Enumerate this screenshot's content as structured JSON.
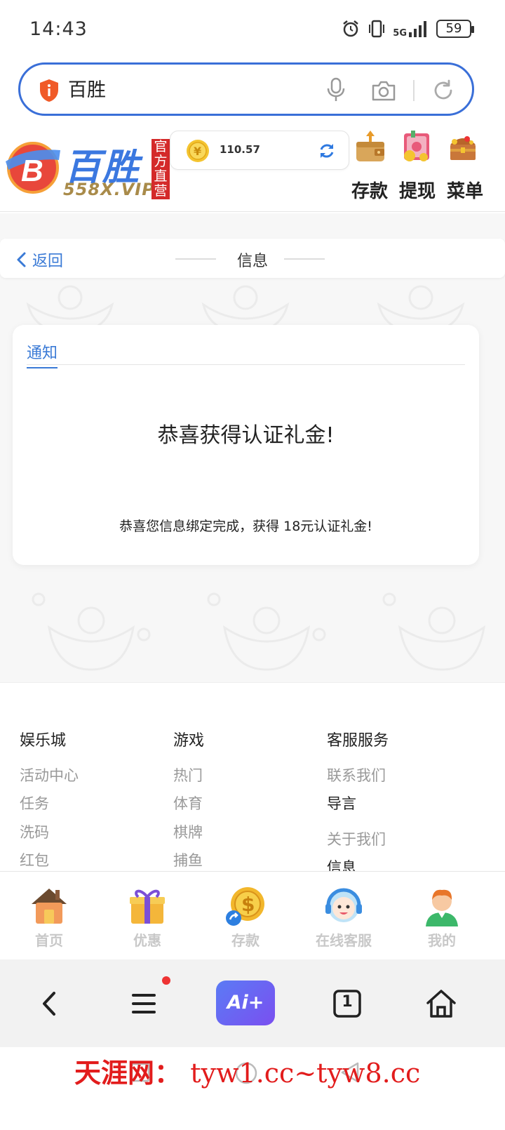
{
  "status_bar": {
    "time": "14:43",
    "network": "5G",
    "battery": "59"
  },
  "search_bar": {
    "query": "百胜"
  },
  "site_header": {
    "brand": "百胜",
    "domain": "558X.VIP",
    "official_badge": "官方直营",
    "balance": "110.57",
    "actions": [
      {
        "label": "存款",
        "icon": "wallet-icon"
      },
      {
        "label": "提现",
        "icon": "safe-icon"
      },
      {
        "label": "菜单",
        "icon": "treasure-chest-icon"
      }
    ]
  },
  "nav": {
    "back_label": "返回",
    "title": "信息"
  },
  "notice": {
    "tab_label": "通知",
    "headline": "恭喜获得认证礼金!",
    "message": "恭喜您信息绑定完成，获得 18元认证礼金!"
  },
  "footer": {
    "columns": [
      {
        "title": "娱乐城",
        "links": [
          "活动中心",
          "任务",
          "洗码",
          "红包"
        ]
      },
      {
        "title": "游戏",
        "links": [
          "热门",
          "体育",
          "棋牌",
          "捕鱼"
        ]
      },
      {
        "title": "客服服务",
        "links": [
          "联系我们",
          "导言",
          "关于我们",
          "信息"
        ]
      }
    ]
  },
  "tabbar": {
    "items": [
      {
        "label": "首页",
        "icon": "home-icon"
      },
      {
        "label": "优惠",
        "icon": "gift-icon"
      },
      {
        "label": "存款",
        "icon": "coin-deposit-icon"
      },
      {
        "label": "在线客服",
        "icon": "support-agent-icon"
      },
      {
        "label": "我的",
        "icon": "user-icon"
      }
    ]
  },
  "browser_toolbar": {
    "ai_label": "Ai+",
    "tab_count": "1"
  },
  "watermark": {
    "name": "天涯网：",
    "urls": "tyw1.cc~tyw8.cc"
  },
  "colors": {
    "accent": "#3a7ad6",
    "brand_blue": "#3b78e0",
    "badge_red": "#d42a2a",
    "watermark_red": "#e21c1c"
  }
}
